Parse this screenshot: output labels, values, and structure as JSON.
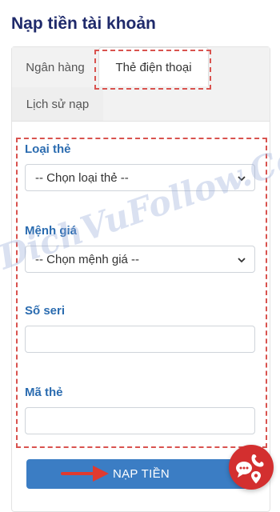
{
  "page": {
    "title": "Nạp tiền tài khoản"
  },
  "tabs": {
    "bank": "Ngân hàng",
    "phone_card": "Thẻ điện thoại",
    "history": "Lịch sử nạp"
  },
  "form": {
    "card_type": {
      "label": "Loại thẻ",
      "selected": "-- Chọn loại thẻ --"
    },
    "denomination": {
      "label": "Mệnh giá",
      "selected": "-- Chọn mệnh giá --"
    },
    "serial": {
      "label": "Số seri",
      "value": ""
    },
    "card_code": {
      "label": "Mã thẻ",
      "value": ""
    },
    "submit_label": "NẠP TIỀN"
  },
  "watermark": "DichVuFollow.Com",
  "colors": {
    "title": "#1f2a6b",
    "label": "#2b6cb0",
    "button": "#3b7dc4",
    "highlight": "#d9534f",
    "chat": "#d32f2f"
  },
  "icons": {
    "select_arrow": "chevron-down-icon",
    "pointer": "arrow-right-icon",
    "chat": "chat-phone-location-icon"
  }
}
